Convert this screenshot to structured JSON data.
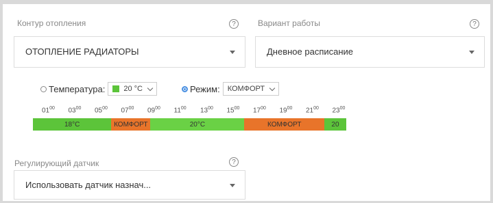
{
  "heating": {
    "label": "Контур отопления",
    "help": "?",
    "value": "ОТОПЛЕНИЕ РАДИАТОРЫ"
  },
  "mode": {
    "label": "Вариант работы",
    "help": "?",
    "value": "Дневное расписание"
  },
  "temperature_option": {
    "label": "Температура:",
    "swatch_color": "#5cc43a",
    "value": "20 °C"
  },
  "regime_option": {
    "label": "Режим:",
    "value": "КОМФОРТ"
  },
  "schedule": {
    "hours": [
      "01",
      "03",
      "05",
      "07",
      "09",
      "11",
      "13",
      "15",
      "17",
      "19",
      "21",
      "23"
    ],
    "minutes": "00",
    "segments": [
      {
        "label": "18°C",
        "color": "#5cc43a",
        "fraction": 0.25
      },
      {
        "label": "КОМФОРТ",
        "color": "#e8742a",
        "fraction": 0.125
      },
      {
        "label": "20°C",
        "color": "#6ad145",
        "fraction": 0.3
      },
      {
        "label": "КОМФОРТ",
        "color": "#e8742a",
        "fraction": 0.255
      },
      {
        "label": "20",
        "color": "#5cc43a",
        "fraction": 0.07
      }
    ]
  },
  "sensor": {
    "label": "Регулирующий датчик",
    "help": "?",
    "value": "Использовать датчик назнач..."
  }
}
